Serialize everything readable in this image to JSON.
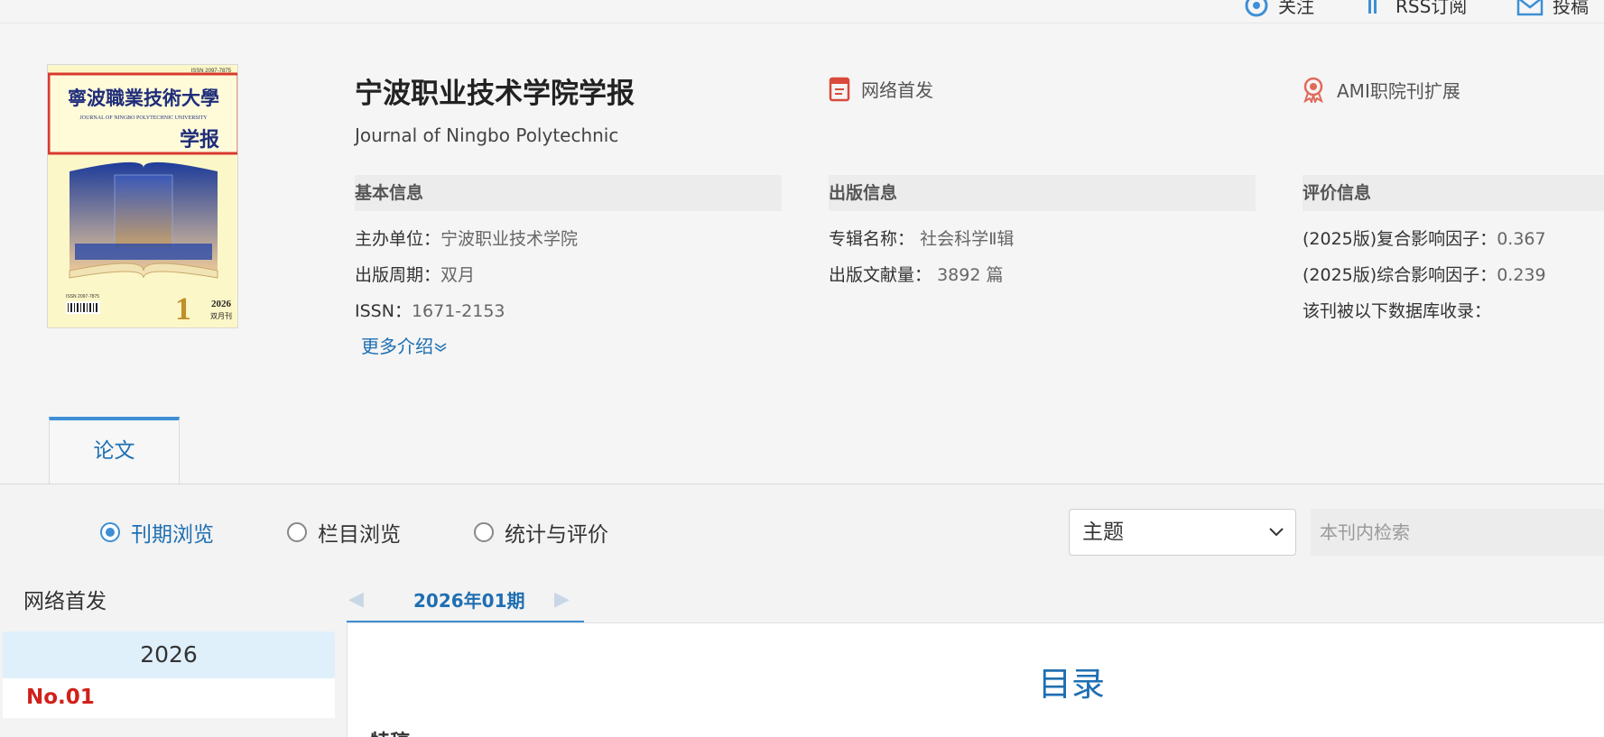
{
  "topbar": {
    "follow_label": "关注",
    "rss_label": "RSS订阅",
    "submit_label": "投稿"
  },
  "journal": {
    "title": "宁波职业技术学院学报",
    "english_title": "Journal of Ningbo Polytechnic",
    "badge_online": "网络首发",
    "badge_ami": "AMI职院刊扩展",
    "cover": {
      "issn_top": "ISSN 2097-7875",
      "name_cn": "寧波職業技術大學",
      "name_en": "JOURNAL OF NINGBO POLYTECHNIC UNIVERSITY",
      "subtitle": "学报",
      "issue_number": "1",
      "year": "2026",
      "freq": "双月刊",
      "issn_bottom": "ISSN 2097-7875"
    }
  },
  "basic_info": {
    "heading": "基本信息",
    "sponsor_label": "主办单位：",
    "sponsor_value": "宁波职业技术学院",
    "cycle_label": "出版周期：",
    "cycle_value": "双月",
    "issn_label": "ISSN：",
    "issn_value": "1671-2153",
    "more_label": "更多介绍"
  },
  "publish_info": {
    "heading": "出版信息",
    "album_label": "专辑名称：",
    "album_value": "社会科学Ⅱ辑",
    "count_label": "出版文献量：",
    "count_value": "3892 篇"
  },
  "eval_info": {
    "heading": "评价信息",
    "composite_label": "(2025版)复合影响因子：",
    "composite_value": "0.367",
    "comprehensive_label": "(2025版)综合影响因子：",
    "comprehensive_value": "0.239",
    "db_label": "该刊被以下数据库收录："
  },
  "tabs": {
    "paper": "论文"
  },
  "browse": {
    "options": [
      "刊期浏览",
      "栏目浏览",
      "统计与评价"
    ],
    "selected": "刊期浏览",
    "select_value": "主题",
    "search_placeholder": "本刊内检索"
  },
  "sidebar": {
    "online_first": "网络首发",
    "year": "2026",
    "issue_no": "No.01"
  },
  "issue": {
    "current": "2026年01期",
    "toc_title": "目录",
    "section": "特稿"
  },
  "colors": {
    "accent": "#1e6fb2",
    "tab_border": "#3d8fd6",
    "issue_red": "#d0201a",
    "year_bg": "#dff0fb"
  }
}
